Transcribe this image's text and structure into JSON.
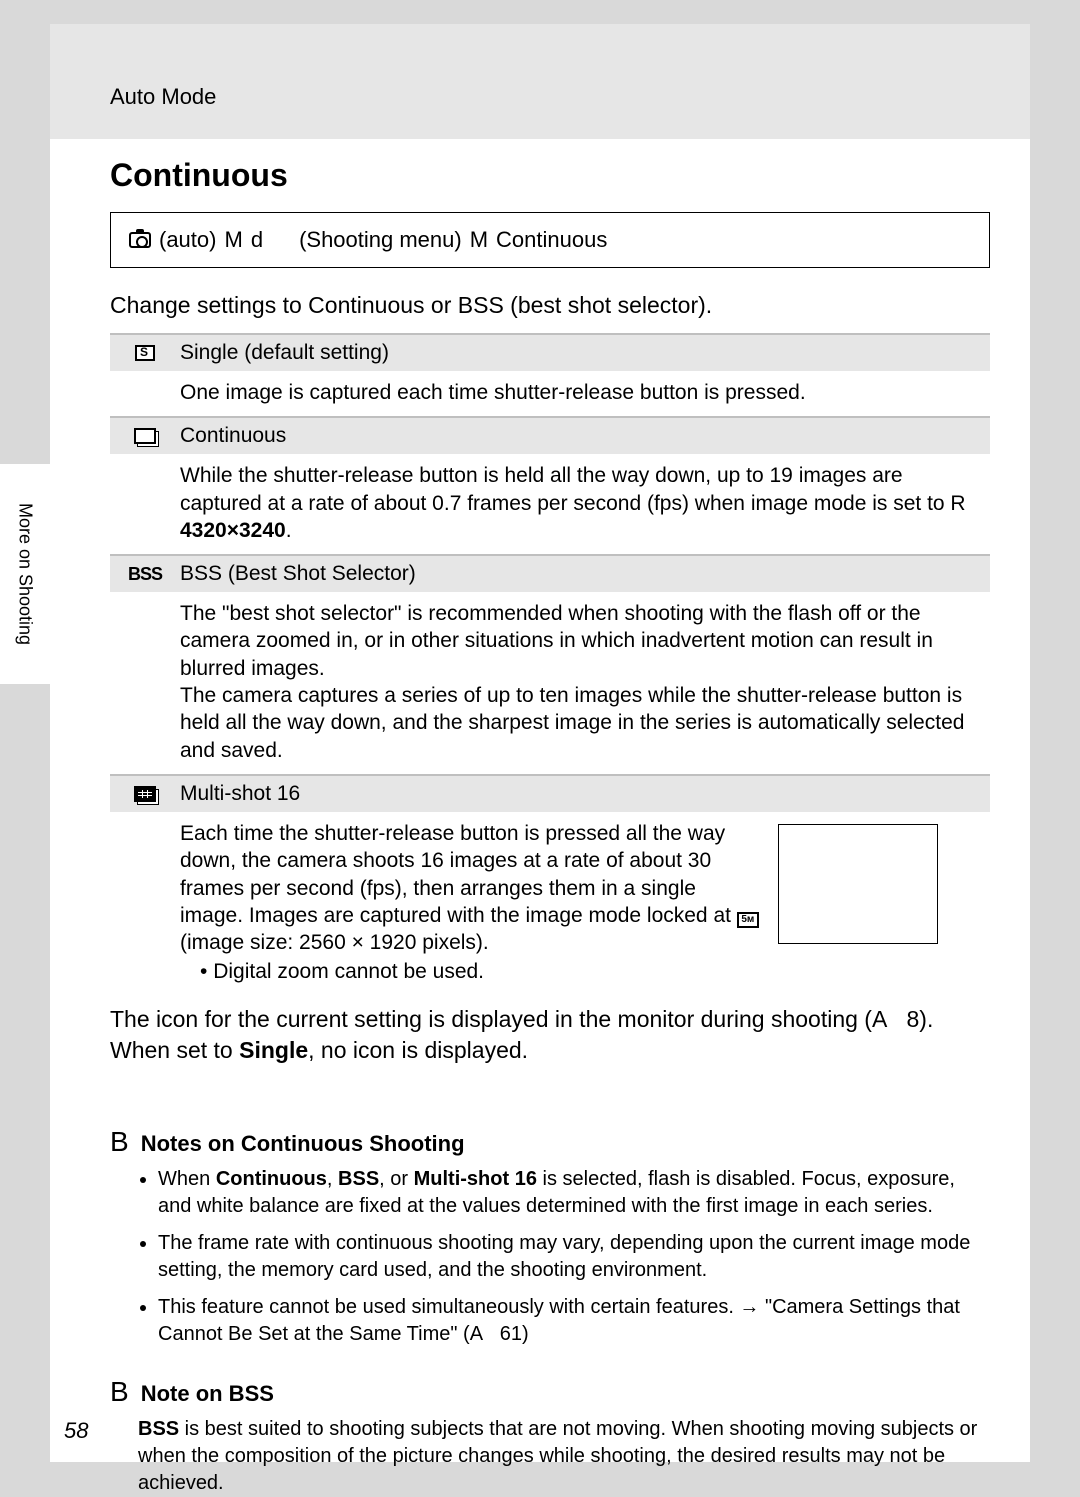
{
  "header": {
    "mode": "Auto Mode"
  },
  "title": "Continuous",
  "side_tab": "More on Shooting",
  "menu_path": {
    "auto": "(auto)",
    "m1": "M",
    "d": "d",
    "shooting_menu": "(Shooting menu)",
    "m2": "M",
    "continuous": "Continuous"
  },
  "intro": "Change settings to Continuous or BSS (best shot selector).",
  "rows": {
    "single": {
      "label": "Single (default setting)",
      "body": "One image is captured each time shutter-release button is pressed."
    },
    "continuous": {
      "label": "Continuous",
      "body_pre": "While the shutter-release button is held all the way down, up to 19 images are captured at a rate of about 0.7 frames per second (fps) when image mode is set to ",
      "body_mode_prefix": "R ",
      "body_mode": "4320×3240",
      "body_suffix": "."
    },
    "bss": {
      "label": "BSS (Best Shot Selector)",
      "body": "The \"best shot selector\" is recommended when shooting with the flash off or the camera zoomed in, or in other situations in which inadvertent motion can result in blurred images.\nThe camera captures a series of up to ten images while the shutter-release button is held all the way down, and the sharpest image in the series is automatically selected and saved."
    },
    "multishot": {
      "label": "Multi-shot 16",
      "body_pre": "Each time the shutter-release button is pressed all the way down, the camera shoots 16 images at a rate of about 30 frames per second (fps), then arranges them in a single image. Images are captured with the image mode locked at ",
      "body_size": " (image size: 2560 × 1920 pixels).",
      "bullet": "Digital zoom cannot be used."
    }
  },
  "after_table_1": "The icon for the current setting is displayed in the monitor during shooting (",
  "after_table_ref": "A   8",
  "after_table_2": "). When set to ",
  "after_table_bold": "Single",
  "after_table_3": ", no icon is displayed.",
  "notes": {
    "cont": {
      "title": "Notes on Continuous Shooting",
      "items": [
        {
          "pre": "When ",
          "b1": "Continuous",
          "mid1": ", ",
          "b2": "BSS",
          "mid2": ", or ",
          "b3": "Multi-shot 16",
          "post": " is selected, flash is disabled. Focus, exposure, and white balance are fixed at the values determined with the first image in each series."
        },
        {
          "text": "The frame rate with continuous shooting may vary, depending upon the current image mode setting, the memory card used, and the shooting environment."
        },
        {
          "pre": "This feature cannot be used simultaneously with certain features. → \"Camera Settings that Cannot Be Set at the Same Time\" (",
          "ref": "A   61",
          "post": ")"
        }
      ]
    },
    "bss": {
      "title": "Note on BSS",
      "body_b": "BSS",
      "body": " is best suited to shooting subjects that are not moving. When shooting moving subjects or when the composition of the picture changes while shooting, the desired results may not be achieved."
    }
  },
  "page_number": "58"
}
